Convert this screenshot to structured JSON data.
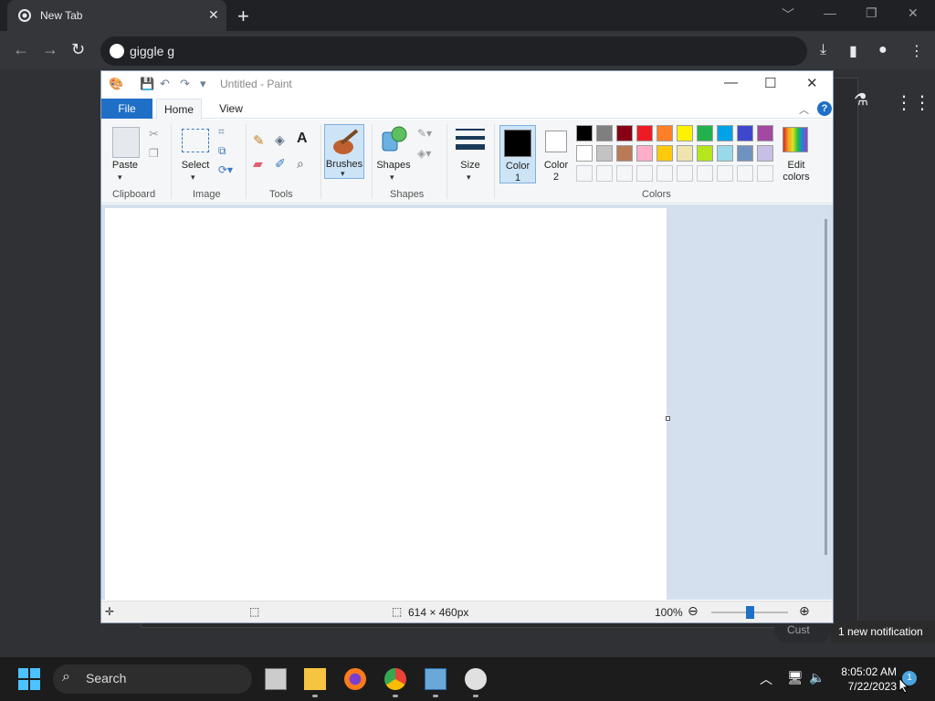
{
  "browser": {
    "tab_title": "New Tab",
    "tab_close": "✕",
    "new_tab": "+",
    "address": "giggle g",
    "win_controls": [
      "﹀",
      "—",
      "❐",
      "✕"
    ]
  },
  "paint": {
    "title": "Untitled - Paint",
    "tabs": {
      "file": "File",
      "home": "Home",
      "view": "View"
    },
    "help": "?",
    "groups": {
      "clipboard": "Clipboard",
      "image": "Image",
      "tools": "Tools",
      "shapes": "Shapes",
      "colors": "Colors"
    },
    "buttons": {
      "paste": "Paste",
      "select": "Select",
      "brushes": "Brushes",
      "shapes": "Shapes",
      "size": "Size",
      "color1": "Color\n1",
      "color1_a": "Color",
      "color1_b": "1",
      "color2_a": "Color",
      "color2_b": "2",
      "edit_a": "Edit",
      "edit_b": "colors"
    },
    "palette_row1": [
      "#000000",
      "#7f7f7f",
      "#880015",
      "#ed1c24",
      "#ff7f27",
      "#fff200",
      "#22b14c",
      "#00a2e8",
      "#3f48cc",
      "#a349a4"
    ],
    "palette_row2": [
      "#ffffff",
      "#c3c3c3",
      "#b97a57",
      "#ffaec9",
      "#ffc90e",
      "#efe4b0",
      "#b5e61d",
      "#99d9ea",
      "#7092be",
      "#c8bfe7"
    ],
    "status": {
      "canvas_size": "614 × 460px",
      "zoom": "100%"
    }
  },
  "overlay": {
    "notification_toast": "1 new notification",
    "custom_btn": "Cust"
  },
  "taskbar": {
    "search": "Search",
    "time": "8:05:02 AM",
    "date": "7/22/2023",
    "notif_count": "1"
  }
}
